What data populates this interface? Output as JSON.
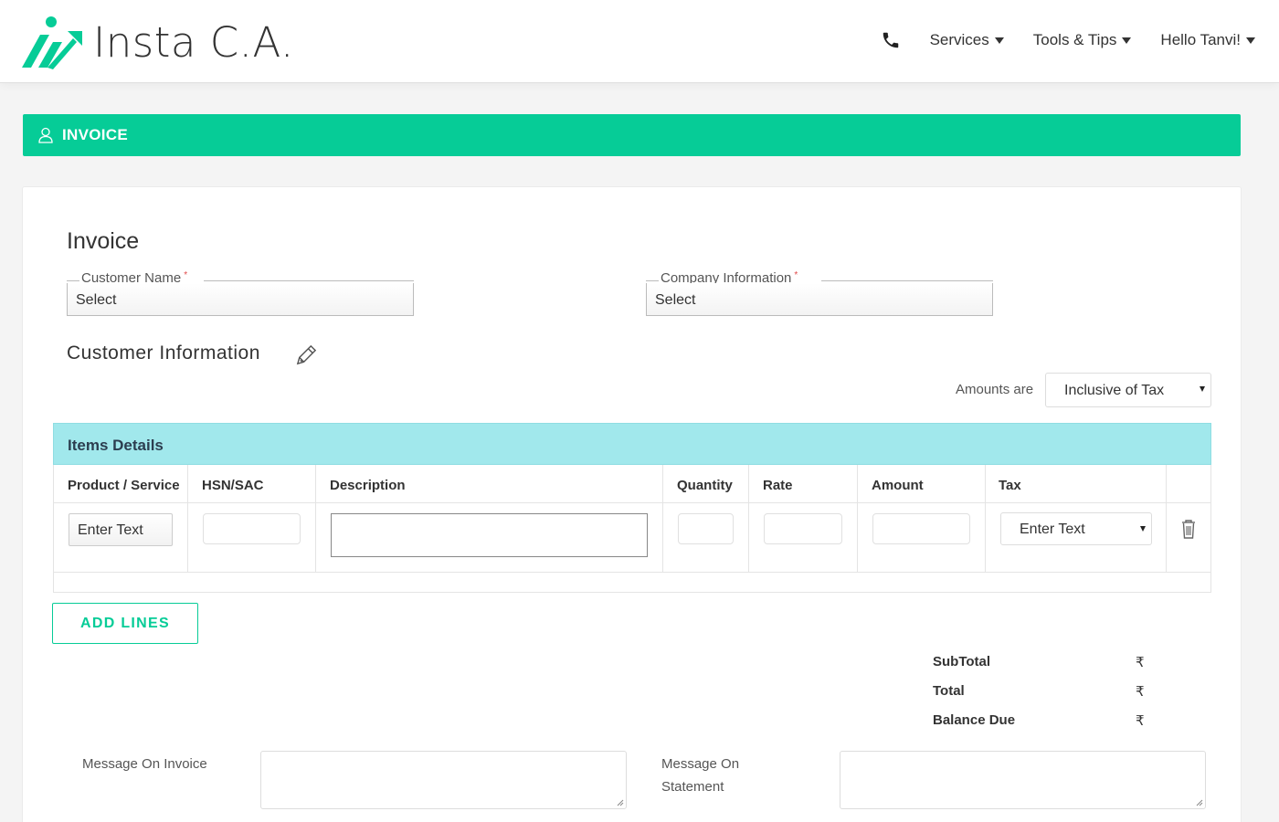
{
  "brand": {
    "name": "Insta C.A.",
    "accent": "#06cc97",
    "icon": "insta-ca-logo"
  },
  "nav": {
    "phone_icon": "phone-icon",
    "items": [
      {
        "label": "Services"
      },
      {
        "label": "Tools & Tips"
      },
      {
        "label": "Hello Tanvi!"
      }
    ]
  },
  "banner": {
    "icon": "user-icon",
    "title": "INVOICE"
  },
  "form": {
    "title": "Invoice",
    "customer_name": {
      "label": "Customer Name",
      "required": "*",
      "value": "Select"
    },
    "company_info": {
      "label": "Company Information",
      "required": "*",
      "value": "Select"
    },
    "customer_information": {
      "label": "Customer Information",
      "icon": "pencil-icon"
    },
    "amounts": {
      "label": "Amounts are",
      "value": "Inclusive of Tax"
    }
  },
  "items": {
    "title": "Items Details",
    "headers": [
      "Product / Service",
      "HSN/SAC",
      "Description",
      "Quantity",
      "Rate",
      "Amount",
      "Tax"
    ],
    "row": {
      "product": "Enter Text",
      "tax": "Enter Text"
    },
    "add_lines": "ADD LINES"
  },
  "totals": {
    "subtotal_label": "SubTotal",
    "total_label": "Total",
    "balance_label": "Balance Due",
    "currency": "₹"
  },
  "messages": {
    "invoice_label": "Message On Invoice",
    "statement_label_1": "Message On",
    "statement_label_2": "Statement"
  }
}
